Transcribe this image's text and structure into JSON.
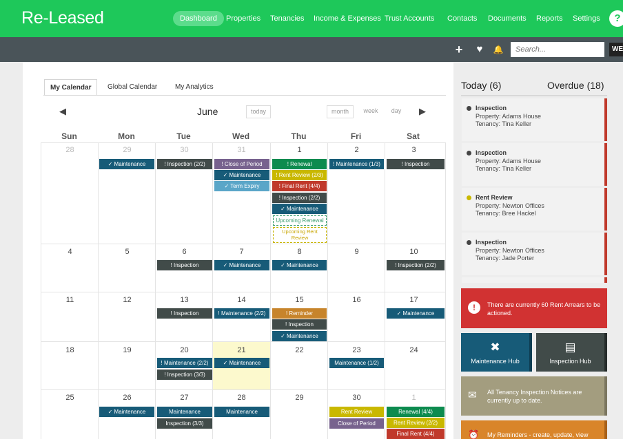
{
  "app": {
    "logo": "Re-Leased"
  },
  "nav": [
    {
      "label": "Dashboard",
      "active": true
    },
    {
      "label": "Properties"
    },
    {
      "label": "Tenancies"
    },
    {
      "label": "Income & Expenses"
    },
    {
      "label": "Trust  Accounts"
    },
    {
      "label": "Contacts"
    },
    {
      "label": "Documents"
    },
    {
      "label": "Reports"
    },
    {
      "label": "Settings"
    }
  ],
  "help_label": "?",
  "toolbar": {
    "add_icon": "+",
    "pulse_icon": "♥",
    "bell_icon": "🔔",
    "search_placeholder": "Search...",
    "user_label": "WE"
  },
  "tabs": [
    {
      "label": "My Calendar",
      "selected": true
    },
    {
      "label": "Global Calendar"
    },
    {
      "label": "My Analytics"
    }
  ],
  "calendar": {
    "month": "June",
    "prev": "◀",
    "next": "▶",
    "today_label": "today",
    "views": [
      "month",
      "week",
      "day"
    ],
    "weekdays": [
      "Sun",
      "Mon",
      "Tue",
      "Wed",
      "Thu",
      "Fri",
      "Sat"
    ],
    "days": [
      "28",
      "29",
      "30",
      "31",
      "1",
      "2",
      "3",
      "4",
      "5",
      "6",
      "7",
      "8",
      "9",
      "10",
      "11",
      "12",
      "13",
      "14",
      "15",
      "16",
      "17",
      "18",
      "19",
      "20",
      "21",
      "22",
      "23",
      "24",
      "25",
      "26",
      "27",
      "28",
      "29",
      "30",
      "1"
    ],
    "events": [
      {
        "label": "✓ Maintenance",
        "color": "#175b78"
      },
      {
        "label": "! Inspection (2/2)",
        "color": "#414b49"
      },
      {
        "label": "! Close of Period",
        "color": "#77628e"
      },
      {
        "label": "✓ Maintenance",
        "color": "#175b78"
      },
      {
        "label": "✓ Term Expiry",
        "color": "#5aa6c8"
      },
      {
        "label": "! Renewal",
        "color": "#0d8b4f"
      },
      {
        "label": "! Rent Review (2/3)",
        "color": "#c9b800"
      },
      {
        "label": "! Final Rent (4/4)",
        "color": "#c0392b"
      },
      {
        "label": "! Inspection (2/2)",
        "color": "#414b49"
      },
      {
        "label": "✓ Maintenance",
        "color": "#175b78"
      },
      {
        "label": "Upcoming Renewal",
        "color": "#3b9e6e"
      },
      {
        "label": "Upcoming Rent Review",
        "color": "#c8a500"
      },
      {
        "label": "! Maintenance (1/3)",
        "color": "#175b78"
      },
      {
        "label": "! Inspection",
        "color": "#414b49"
      },
      {
        "label": "! Inspection",
        "color": "#414b49"
      },
      {
        "label": "✓ Maintenance",
        "color": "#175b78"
      },
      {
        "label": "✓ Maintenance",
        "color": "#175b78"
      },
      {
        "label": "! Inspection (2/2)",
        "color": "#414b49"
      },
      {
        "label": "! Inspection",
        "color": "#414b49"
      },
      {
        "label": "! Maintenance (2/2)",
        "color": "#175b78"
      },
      {
        "label": "! Reminder",
        "color": "#c7842b"
      },
      {
        "label": "! Inspection",
        "color": "#414b49"
      },
      {
        "label": "✓ Maintenance",
        "color": "#175b78"
      },
      {
        "label": "✓ Maintenance",
        "color": "#175b78"
      },
      {
        "label": "! Maintenance (2/2)",
        "color": "#175b78"
      },
      {
        "label": "! Inspection (3/3)",
        "color": "#414b49"
      },
      {
        "label": "✓ Maintenance",
        "color": "#175b78"
      },
      {
        "label": "Maintenance (1/2)",
        "color": "#175b78"
      },
      {
        "label": "✓ Maintenance",
        "color": "#175b78"
      },
      {
        "label": "Maintenance",
        "color": "#175b78"
      },
      {
        "label": "Inspection (3/3)",
        "color": "#414b49"
      },
      {
        "label": "Maintenance",
        "color": "#175b78"
      },
      {
        "label": "Rent Review",
        "color": "#c9b800"
      },
      {
        "label": "Close of Period",
        "color": "#77628e"
      },
      {
        "label": "Renewal (4/4)",
        "color": "#0d8b4f"
      },
      {
        "label": "Rent Review (2/2)",
        "color": "#c9b800"
      },
      {
        "label": "Final Rent (4/4)",
        "color": "#c0392b"
      }
    ]
  },
  "sidebar": {
    "today": "Today (6)",
    "overdue": "Overdue (18)",
    "items": [
      {
        "title": "Inspection",
        "property": "Property: Adams House",
        "tenancy": "Tenancy: Tina Keller",
        "dot": "#444444"
      },
      {
        "title": "Inspection",
        "property": "Property: Adams House",
        "tenancy": "Tenancy: Tina Keller",
        "dot": "#444444"
      },
      {
        "title": "Rent Review",
        "property": "Property: Newton Offices",
        "tenancy": "Tenancy: Bree Hackel",
        "dot": "#c9b800"
      },
      {
        "title": "Inspection",
        "property": "Property: Newton Offices",
        "tenancy": "Tenancy: Jade Porter",
        "dot": "#444444"
      }
    ],
    "arrears_icon": "!",
    "arrears": "There are currently 60 Rent Arrears to be actioned.",
    "maintenance_hub": "Maintenance Hub",
    "maintenance_icon": "✖",
    "inspection_hub": "Inspection Hub",
    "inspection_icon": "▤",
    "notice_icon": "✉",
    "notice": "All Tenancy Inspection Notices are currently up to date.",
    "reminders_icon": "⏰",
    "reminders": "My Reminders - create, update, view"
  },
  "colors": {
    "brand": "#1ec85a",
    "subbar": "#4a5459",
    "arrears": "#d13232",
    "maintenance_tile": "#175b78",
    "inspection_tile": "#414b49",
    "notice_tile": "#a39d7f",
    "reminder_tile": "#d9852a"
  }
}
